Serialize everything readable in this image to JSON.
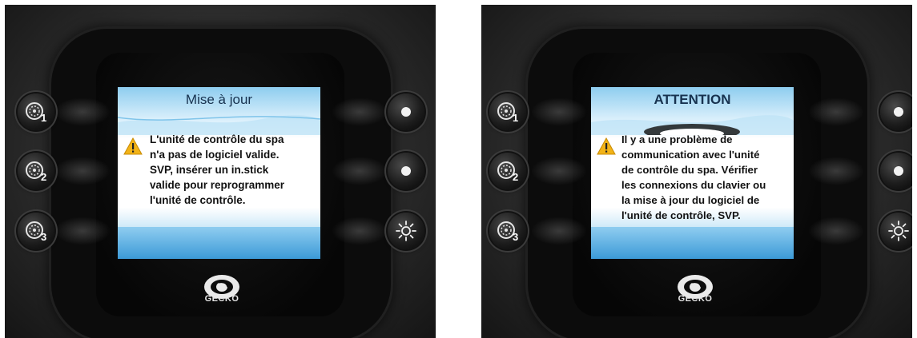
{
  "brand": "GECKO",
  "colors": {
    "screen_blue": "#5fb3e6",
    "warning_yellow": "#f2b318",
    "panel_black": "#0c0c0c"
  },
  "panels": [
    {
      "title": "Mise à jour",
      "title_bold": false,
      "warning_icon": "warning-triangle-icon",
      "message_lines": [
        "L'unité de contrôle du spa",
        "n'a pas de logiciel valide.",
        "SVP, insérer un in.stick",
        "valide pour reprogrammer",
        "l'unité de contrôle."
      ]
    },
    {
      "title": "ATTENTION",
      "title_bold": true,
      "warning_icon": "warning-triangle-icon",
      "message_lines": [
        "Il y a une problème de",
        "communication avec l'unité",
        "de contrôle du spa. Vérifier",
        "les connexions du clavier ou",
        "la mise à jour du logiciel de",
        "l'unité de contrôle, SVP."
      ]
    }
  ],
  "left_buttons": [
    {
      "icon": "pump-1-icon",
      "number": "1"
    },
    {
      "icon": "pump-2-icon",
      "number": "2"
    },
    {
      "icon": "pump-3-icon",
      "number": "3"
    }
  ],
  "right_buttons": [
    {
      "icon": "dot-icon"
    },
    {
      "icon": "dot-icon"
    },
    {
      "icon": "light-icon"
    }
  ]
}
